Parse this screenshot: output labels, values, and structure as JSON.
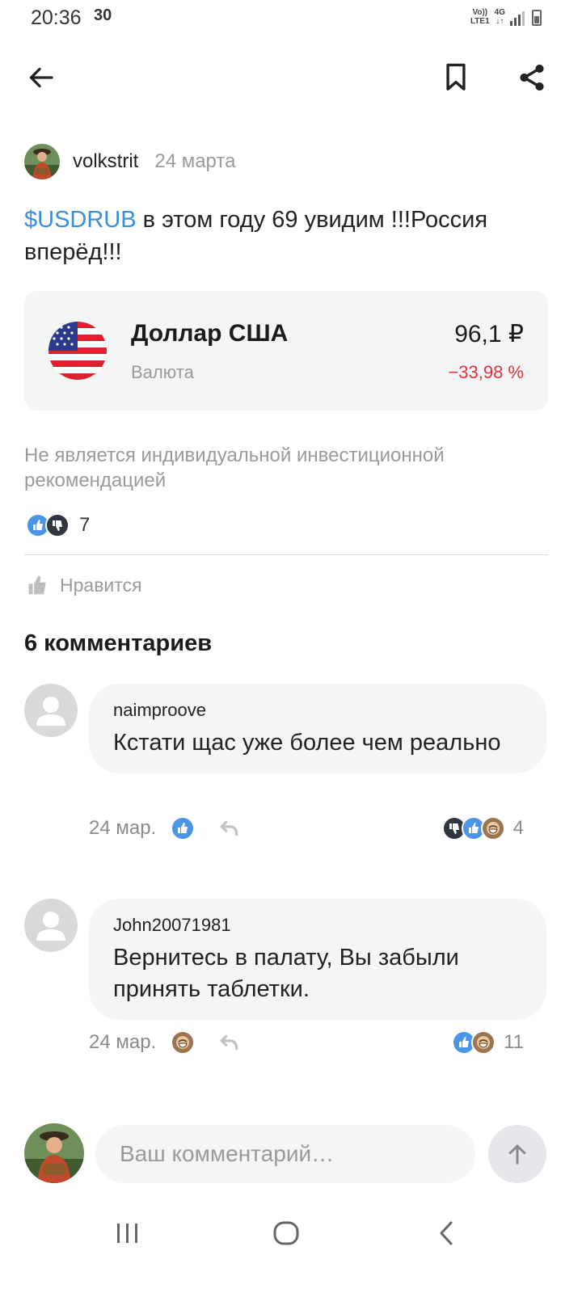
{
  "status_bar": {
    "time": "20:36",
    "extra_icon": "30",
    "network_top": "Vo))",
    "network_bottom": "LTE1",
    "network_type": "4G"
  },
  "toolbar": {
    "back_icon": "arrow-left-icon",
    "bookmark_icon": "bookmark-icon",
    "share_icon": "share-icon"
  },
  "post": {
    "author": "volkstrit",
    "date": "24 марта",
    "ticker": "$USDRUB",
    "text": " в этом году 69 увидим !!!Россия вперёд!!!",
    "instrument": {
      "name": "Доллар США",
      "type": "Валюта",
      "price": "96,1 ₽",
      "change": "−33,98 %"
    },
    "disclaimer": "Не является индивидуальной инвестиционной рекомендацией",
    "reactions_count": "7",
    "like_label": "Нравится"
  },
  "comments_title": "6 комментариев",
  "comments": [
    {
      "author": "naimproove",
      "text": "Кстати щас уже более чем реально",
      "date": "24 мар.",
      "reactions_count": "4"
    },
    {
      "author": "John20071981",
      "text": "Вернитесь в палату, Вы забыли принять таблетки.",
      "date": "24 мар.",
      "reactions_count": "11"
    }
  ],
  "composer": {
    "placeholder": "Ваш комментарий…"
  },
  "colors": {
    "accent": "#3a8fdc",
    "negative": "#e0333c",
    "card_bg": "#f4f5f7",
    "muted": "#9a9a9a"
  }
}
